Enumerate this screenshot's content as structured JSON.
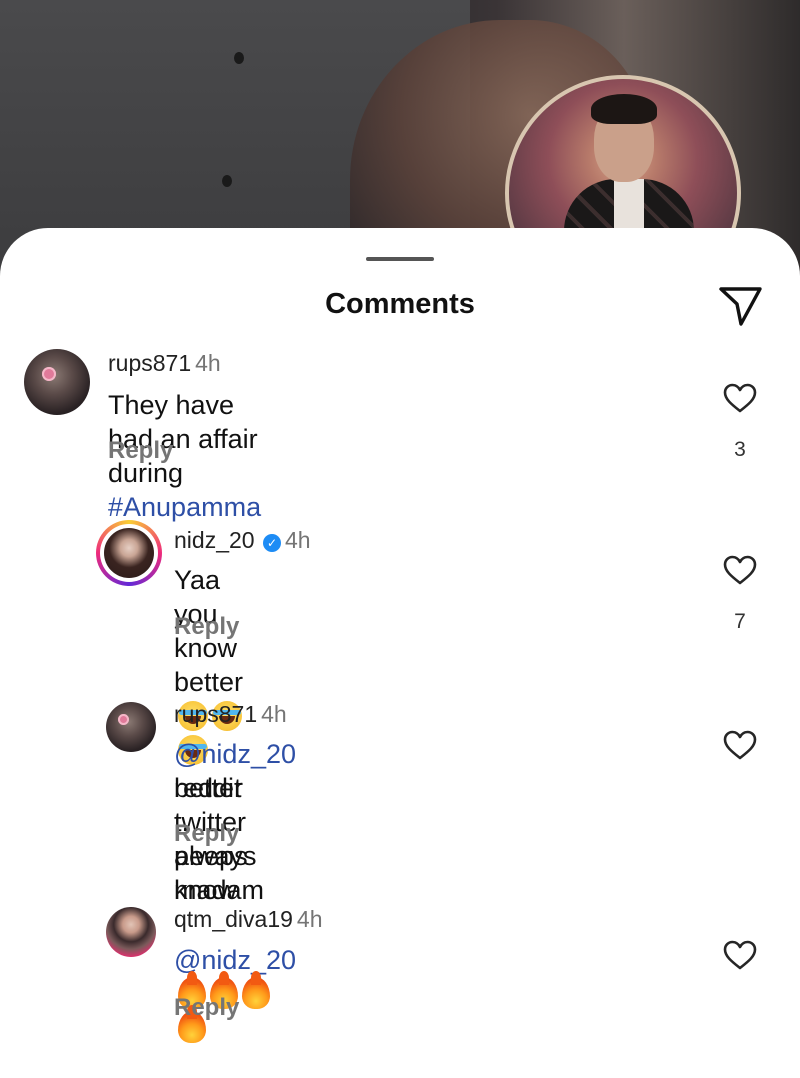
{
  "sheet": {
    "title": "Comments"
  },
  "comments": [
    {
      "username": "rups871",
      "time": "4h",
      "text_plain": "They have had an affair during ",
      "hashtag": "#Anupamma",
      "reply_label": "Reply",
      "like_count": "3"
    },
    {
      "username": "nidz_20",
      "verified": true,
      "time": "4h",
      "text_plain": "Yaa you know better",
      "emojis": [
        "laughing-crying-emoji",
        "laughing-crying-emoji",
        "laughing-crying-emoji"
      ],
      "reply_label": "Reply",
      "like_count": "7"
    },
    {
      "username": "rups871",
      "time": "4h",
      "mention": "@nidz_20",
      "text_line1": " reddit twitter peeps know",
      "text_line2": "better .. always madam",
      "reply_label": "Reply"
    },
    {
      "username": "qtm_diva19",
      "time": "4h",
      "mention": "@nidz_20",
      "emojis": [
        "fire-emoji",
        "fire-emoji",
        "fire-emoji",
        "fire-emoji"
      ],
      "reply_label": "Reply"
    }
  ],
  "colors": {
    "mention": "#2e4fa6",
    "secondary_text": "#757575",
    "verified_badge": "#1d8cf5"
  }
}
